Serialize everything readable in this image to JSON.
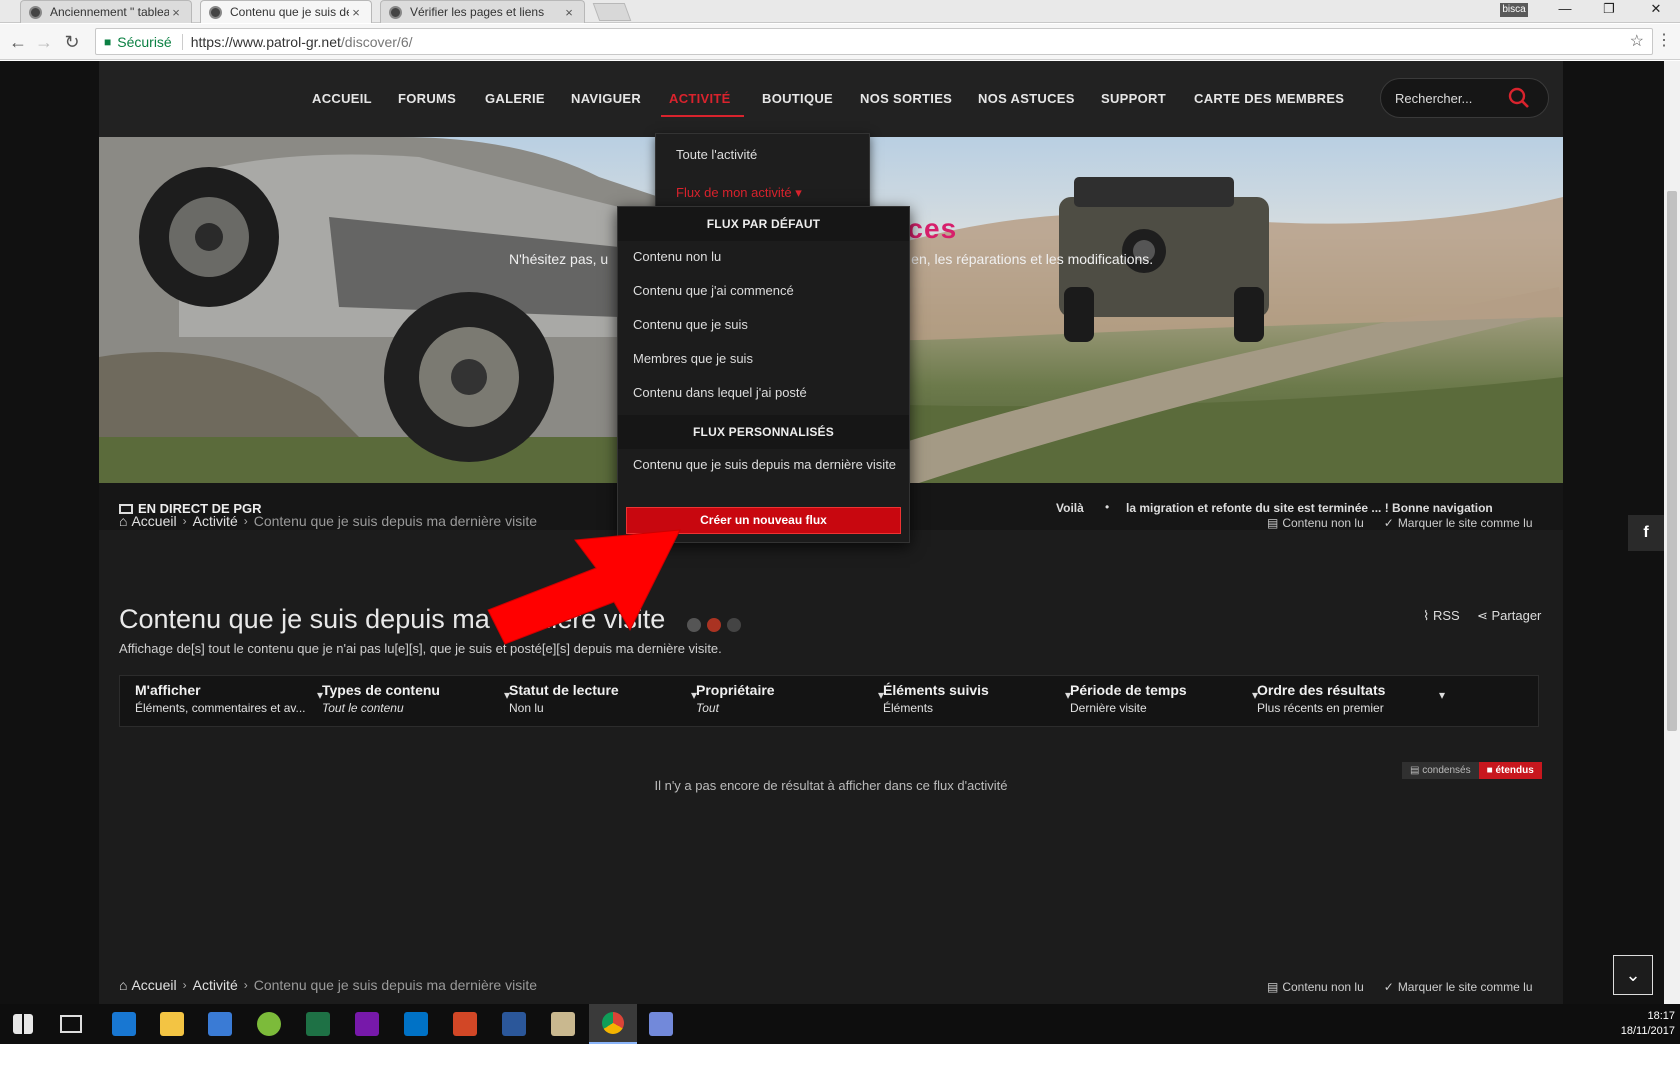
{
  "browser": {
    "tabs": [
      {
        "label": "Anciennement \" tableau"
      },
      {
        "label": "Contenu que je suis dep"
      },
      {
        "label": "Vérifier les pages et liens"
      }
    ],
    "close_glyph": "×",
    "profile": "bisca",
    "secure_label": "Sécurisé",
    "url_host": "https://www.patrol-gr.net",
    "url_path": "/discover/6/"
  },
  "nav": {
    "items": [
      "ACCUEIL",
      "FORUMS",
      "GALERIE",
      "NAVIGUER",
      "ACTIVITÉ",
      "BOUTIQUE",
      "NOS SORTIES",
      "NOS ASTUCES",
      "SUPPORT",
      "CARTE DES MEMBRES"
    ],
    "active": "ACTIVITÉ",
    "search_placeholder": "Rechercher..."
  },
  "hero": {
    "title_fragment": "tuces",
    "text_left": "N'hésitez pas, u",
    "text_right": "en, les réparations et les modifications."
  },
  "ticker": {
    "label": "EN DIRECT DE PGR",
    "msg1": "Voilà",
    "msg2": "la migration et refonte du site est terminée ... ! Bonne navigation"
  },
  "breadcrumb": {
    "home": "Accueil",
    "section": "Activité",
    "current": "Contenu que je suis depuis ma dernière visite",
    "unread": "Contenu non lu",
    "mark_read": "Marquer le site comme lu"
  },
  "page": {
    "title": "Contenu que je suis depuis ma dernière visite",
    "description": "Affichage de[s] tout le contenu que je n'ai pas lu[e][s], que je suis et posté[e][s] depuis ma dernière visite.",
    "rss": "RSS",
    "share": "Partager",
    "empty": "Il n'y a pas encore de résultat à afficher dans ce flux d'activité"
  },
  "filters": [
    {
      "label": "M'afficher",
      "value": "Éléments, commentaires et av...",
      "italic": false
    },
    {
      "label": "Types de contenu",
      "value": "Tout le contenu",
      "italic": true
    },
    {
      "label": "Statut de lecture",
      "value": "Non lu",
      "italic": false
    },
    {
      "label": "Propriétaire",
      "value": "Tout",
      "italic": true
    },
    {
      "label": "Éléments suivis",
      "value": "Éléments",
      "italic": false
    },
    {
      "label": "Période de temps",
      "value": "Dernière visite",
      "italic": false
    },
    {
      "label": "Ordre des résultats",
      "value": "Plus récents en premier",
      "italic": false
    }
  ],
  "view_toggle": {
    "condensed": "condensés",
    "extended": "étendus"
  },
  "activity_menu": {
    "all": "Toute l'activité",
    "my_streams": "Flux de mon activité"
  },
  "streams_menu": {
    "default_header": "FLUX PAR DÉFAUT",
    "default_items": [
      "Contenu non lu",
      "Contenu que j'ai commencé",
      "Contenu que je suis",
      "Membres que je suis",
      "Contenu dans lequel j'ai posté"
    ],
    "custom_header": "FLUX PERSONNALISÉS",
    "custom_items": [
      "Contenu que je suis depuis ma dernière visite"
    ],
    "create_button": "Créer un nouveau flux"
  },
  "social": {
    "facebook": "f"
  },
  "taskbar": {
    "time": "18:17",
    "date": "18/11/2017"
  },
  "colors": {
    "accent": "#d9232d",
    "button_red": "#c8070f",
    "background": "#1c1c1c"
  }
}
